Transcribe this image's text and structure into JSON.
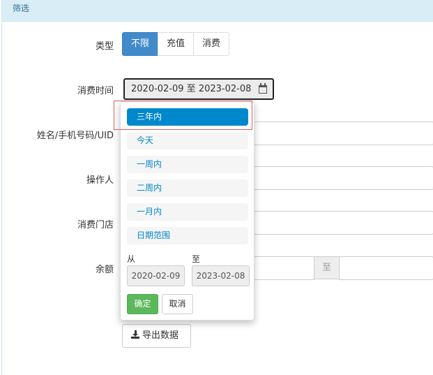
{
  "panel": {
    "heading": "筛选"
  },
  "form": {
    "type_label": "类型",
    "type_options": [
      "不限",
      "充值",
      "消费"
    ],
    "time_label": "消费时间",
    "time_value": "2020-02-09 至 2023-02-08",
    "name_label": "姓名/手机号码/UID",
    "operator_label": "操作人",
    "store_label": "消费门店",
    "balance_label": "余额",
    "balance_sep": "至",
    "export_label": "导出数据"
  },
  "picker": {
    "ranges": [
      "三年内",
      "今天",
      "一周内",
      "二周内",
      "一月内",
      "日期范围"
    ],
    "selected": "三年内",
    "from_label": "从",
    "to_label": "至",
    "from_value": "2020-02-09",
    "to_value": "2023-02-08",
    "ok_label": "确定",
    "cancel_label": "取消"
  },
  "colors": {
    "accent": "#0088cc",
    "active_segment": "#428bca",
    "ok": "#5cb85c",
    "heading_bg": "#d9edf7",
    "highlight": "#e05a5a"
  }
}
